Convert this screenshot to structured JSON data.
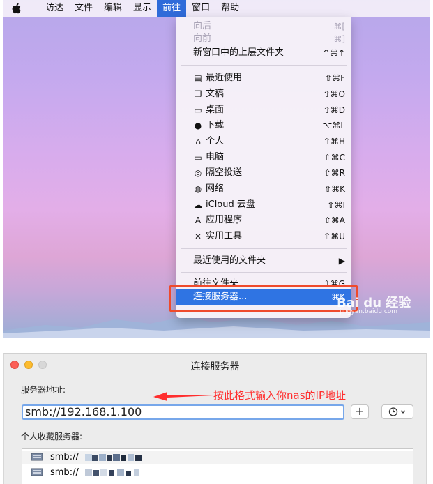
{
  "menubar": {
    "apple_icon": "apple-icon",
    "items": [
      {
        "label": "访达"
      },
      {
        "label": "文件"
      },
      {
        "label": "编辑"
      },
      {
        "label": "显示"
      },
      {
        "label": "前往",
        "active": true
      },
      {
        "label": "窗口"
      },
      {
        "label": "帮助"
      }
    ]
  },
  "go_menu": {
    "back": {
      "label": "向后",
      "shortcut": "⌘["
    },
    "forward": {
      "label": "向前",
      "shortcut": "⌘]"
    },
    "enclosing": {
      "label": "新窗口中的上层文件夹",
      "shortcut": "^⌘↑"
    },
    "places": [
      {
        "icon": "recents-icon",
        "label": "最近使用",
        "shortcut": "⇧⌘F"
      },
      {
        "icon": "documents-icon",
        "label": "文稿",
        "shortcut": "⇧⌘O"
      },
      {
        "icon": "desktop-icon",
        "label": "桌面",
        "shortcut": "⇧⌘D"
      },
      {
        "icon": "downloads-icon",
        "label": "下载",
        "shortcut": "⌥⌘L"
      },
      {
        "icon": "home-icon",
        "label": "个人",
        "shortcut": "⇧⌘H"
      },
      {
        "icon": "computer-icon",
        "label": "电脑",
        "shortcut": "⇧⌘C"
      },
      {
        "icon": "airdrop-icon",
        "label": "隔空投送",
        "shortcut": "⇧⌘R"
      },
      {
        "icon": "network-icon",
        "label": "网络",
        "shortcut": "⇧⌘K"
      },
      {
        "icon": "icloud-icon",
        "label": "iCloud 云盘",
        "shortcut": "⇧⌘I"
      },
      {
        "icon": "applications-icon",
        "label": "应用程序",
        "shortcut": "⇧⌘A"
      },
      {
        "icon": "utilities-icon",
        "label": "实用工具",
        "shortcut": "⇧⌘U"
      }
    ],
    "recent_folders": {
      "label": "最近使用的文件夹",
      "submenu_glyph": "▶"
    },
    "go_to_folder": {
      "label": "前往文件夹...",
      "shortcut": "⇧⌘G"
    },
    "connect_server": {
      "label": "连接服务器...",
      "shortcut": "⌘K"
    },
    "selected_color": "#2f74e3",
    "highlight_color": "#ef4a2c"
  },
  "watermark": {
    "brand": "Bai du 经验",
    "url": "jingyan.baidu.com"
  },
  "dialog": {
    "title": "连接服务器",
    "server_address_label": "服务器地址:",
    "server_address_value": "smb://192.168.1.100",
    "add_button": "+",
    "favorites_label": "个人收藏服务器:",
    "favorites": [
      {
        "prefix": "smb://"
      },
      {
        "prefix": "smb://"
      }
    ]
  },
  "annotation": {
    "text": "按此格式输入你nas的IP地址",
    "color": "#ff2e2e"
  }
}
